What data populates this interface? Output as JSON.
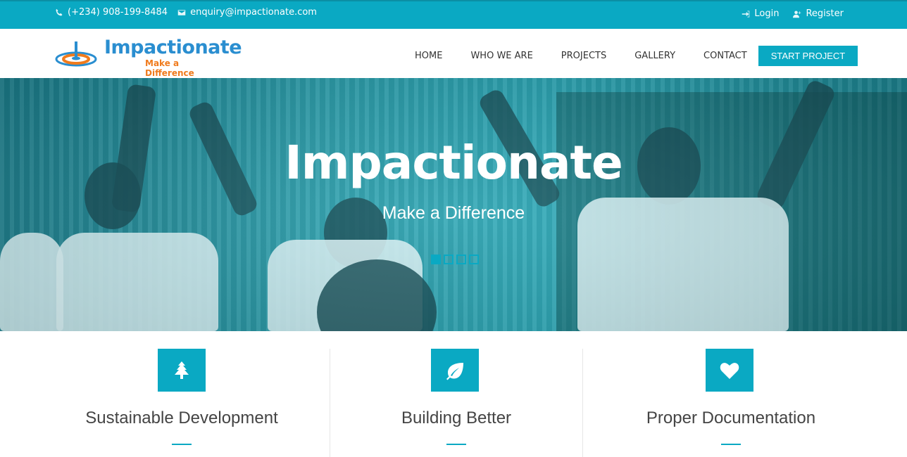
{
  "topbar": {
    "phone": "(+234) 908-199-8484",
    "email": "enquiry@impactionate.com",
    "login": "Login",
    "register": "Register",
    "icons": [
      "phone-icon",
      "envelope-icon",
      "sign-in-icon",
      "user-plus-icon"
    ]
  },
  "logo": {
    "name": "Impactionate",
    "tagline": "Make a Difference"
  },
  "nav": {
    "items": [
      "HOME",
      "WHO WE ARE",
      "PROJECTS",
      "GALLERY",
      "CONTACT"
    ],
    "cta": "START PROJECT"
  },
  "hero": {
    "title": "Impactionate",
    "subtitle": "Make a Difference",
    "slides": 4,
    "active_slide": 1
  },
  "features": [
    {
      "title": "Sustainable Development",
      "icon": "tree-icon"
    },
    {
      "title": "Building Better",
      "icon": "leaf-icon"
    },
    {
      "title": "Proper Documentation",
      "icon": "heart-icon"
    }
  ],
  "colors": {
    "accent": "#0aa9c3",
    "logo_blue": "#2a8ed0",
    "logo_orange": "#f07b1d",
    "text": "#444444"
  }
}
